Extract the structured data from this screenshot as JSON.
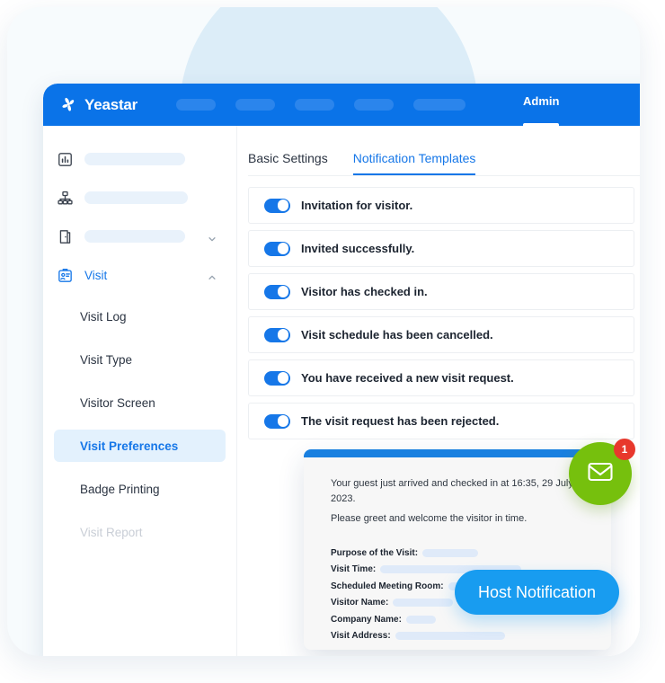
{
  "app": {
    "brand_name": "Yeastar",
    "brand_logo_icon": "yeastar-flower-logo",
    "nav_placeholder_count": 5,
    "admin_label": "Admin"
  },
  "sidebar": {
    "blurred_items": [
      {
        "icon": "bar-chart-icon",
        "has_chevron": false
      },
      {
        "icon": "org-chart-icon",
        "has_chevron": false
      },
      {
        "icon": "door-icon",
        "has_chevron": true,
        "chevron": "chevron-down-icon"
      }
    ],
    "active_group": {
      "icon": "id-badge-icon",
      "label": "Visit",
      "chevron": "chevron-up-icon"
    },
    "sub_items": [
      {
        "label": "Visit Log",
        "state": "normal"
      },
      {
        "label": "Visit Type",
        "state": "normal"
      },
      {
        "label": "Visitor Screen",
        "state": "normal"
      },
      {
        "label": "Visit Preferences",
        "state": "selected"
      },
      {
        "label": "Badge Printing",
        "state": "normal"
      },
      {
        "label": "Visit Report",
        "state": "faded"
      }
    ]
  },
  "content": {
    "tabs": [
      {
        "label": "Basic Settings",
        "active": false
      },
      {
        "label": "Notification Templates",
        "active": true
      }
    ],
    "toggle_rows": [
      {
        "label": "Invitation for visitor.",
        "enabled": true
      },
      {
        "label": "Invited successfully.",
        "enabled": true
      },
      {
        "label": "Visitor has checked in.",
        "enabled": true
      },
      {
        "label": "Visit schedule has been cancelled.",
        "enabled": true
      },
      {
        "label": "You have received a new visit request.",
        "enabled": true
      },
      {
        "label": "The visit request has been rejected.",
        "enabled": true
      }
    ]
  },
  "notification_card": {
    "lines": [
      "Your guest just arrived and checked in at 16:35, 29 July 2023.",
      "Please greet and welcome the visitor in time."
    ],
    "fields": [
      {
        "label": "Purpose of the Visit:",
        "blur_width": 62
      },
      {
        "label": "Visit Time:",
        "blur_width": 157
      },
      {
        "label": "Scheduled Meeting Room:",
        "blur_width": 85
      },
      {
        "label": "Visitor Name:",
        "blur_width": 67
      },
      {
        "label": "Company Name:",
        "blur_width": 33
      },
      {
        "label": "Visit Address:",
        "blur_width": 122
      }
    ]
  },
  "envelope_badge": {
    "icon": "envelope-icon",
    "count": "1",
    "circle_color": "#76c00d",
    "badge_color": "#e8382c"
  },
  "host_pill": {
    "label": "Host Notification",
    "color": "#189cf0"
  },
  "colors": {
    "brand_blue": "#0a73e8",
    "accent_blue": "#1677e8",
    "selected_bg": "#e3f1fd",
    "deco_circle": "#dcedf8"
  }
}
